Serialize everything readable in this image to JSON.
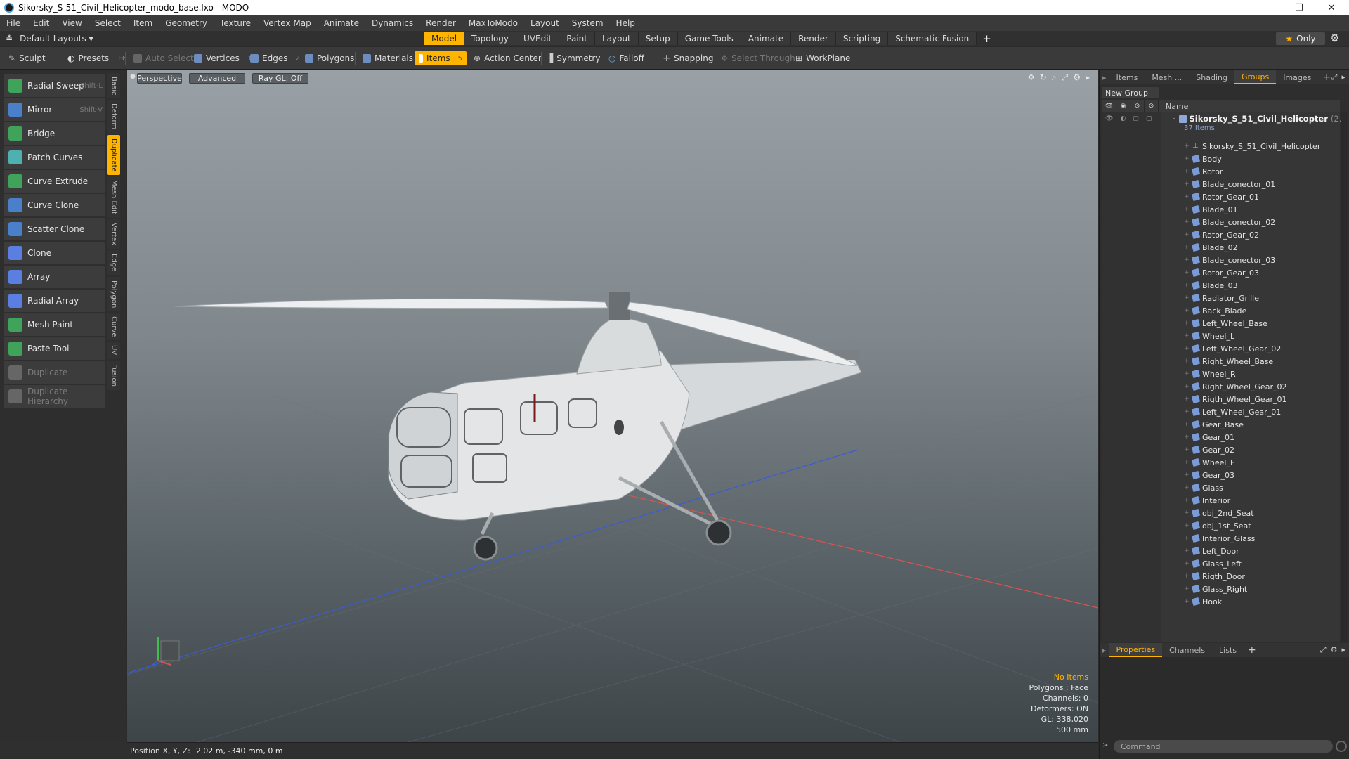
{
  "window": {
    "title": "Sikorsky_S-51_Civil_Helicopter_modo_base.lxo - MODO",
    "controls": [
      "—",
      "❐",
      "✕"
    ]
  },
  "menu": [
    "File",
    "Edit",
    "View",
    "Select",
    "Item",
    "Geometry",
    "Texture",
    "Vertex Map",
    "Animate",
    "Dynamics",
    "Render",
    "MaxToModo",
    "Layout",
    "System",
    "Help"
  ],
  "layoutbar": {
    "layout_selector": "Default Layouts ▾",
    "tabs": [
      "Model",
      "Topology",
      "UVEdit",
      "Paint",
      "Layout",
      "Setup",
      "Game Tools",
      "Animate",
      "Render",
      "Scripting",
      "Schematic Fusion"
    ],
    "active_tab": "Model",
    "plus": "+",
    "only_label": "Only"
  },
  "toolbar": {
    "sculpt": "Sculpt",
    "presets": "Presets",
    "presets_key": "F6",
    "auto_select": "Auto Select",
    "vertices": "Vertices",
    "vertices_count": "1",
    "edges": "Edges",
    "edges_count": "2",
    "polygons": "Polygons",
    "materials": "Materials",
    "items": "Items",
    "items_count": "5",
    "action_center": "Action Center",
    "symmetry": "Symmetry",
    "falloff": "Falloff",
    "snapping": "Snapping",
    "select_through": "Select Through",
    "workplane": "WorkPlane"
  },
  "tools": [
    {
      "label": "Radial Sweep",
      "shortcut": "Shift-L",
      "color": "#3fa35a",
      "enabled": true
    },
    {
      "label": "Mirror",
      "shortcut": "Shift-V",
      "color": "#4a7fc9",
      "enabled": true
    },
    {
      "label": "Bridge",
      "shortcut": "",
      "color": "#3fa35a",
      "enabled": true
    },
    {
      "label": "Patch Curves",
      "shortcut": "",
      "color": "#4fb0b0",
      "enabled": true
    },
    {
      "label": "Curve Extrude",
      "shortcut": "",
      "color": "#3fa35a",
      "enabled": true
    },
    {
      "label": "Curve Clone",
      "shortcut": "",
      "color": "#4a7fc9",
      "enabled": true
    },
    {
      "label": "Scatter Clone",
      "shortcut": "",
      "color": "#4a7fc9",
      "enabled": true
    },
    {
      "label": "Clone",
      "shortcut": "",
      "color": "#5a7fe0",
      "enabled": true
    },
    {
      "label": "Array",
      "shortcut": "",
      "color": "#5a7fe0",
      "enabled": true
    },
    {
      "label": "Radial Array",
      "shortcut": "",
      "color": "#5a7fe0",
      "enabled": true
    },
    {
      "label": "Mesh Paint",
      "shortcut": "",
      "color": "#3fa35a",
      "enabled": true
    },
    {
      "label": "Paste Tool",
      "shortcut": "",
      "color": "#3fa35a",
      "enabled": true
    },
    {
      "label": "Duplicate",
      "shortcut": "",
      "color": "#666666",
      "enabled": false
    },
    {
      "label": "Duplicate Hierarchy",
      "shortcut": "",
      "color": "#666666",
      "enabled": false
    }
  ],
  "vertical_tabs": [
    "Basic",
    "Deform",
    "Duplicate",
    "Mesh Edit",
    "Vertex",
    "Edge",
    "Polygon",
    "Curve",
    "UV",
    "Fusion"
  ],
  "active_vertical_tab": "Duplicate",
  "viewport": {
    "view_mode": "Perspective",
    "shading": "Advanced",
    "raygl": "Ray GL: Off",
    "info": {
      "selection": "No Items",
      "polygons": "Polygons : Face",
      "channels": "Channels: 0",
      "deformers": "Deformers: ON",
      "gl": "GL: 338,020",
      "scale": "500 mm"
    }
  },
  "statusbar": {
    "label": "Position X, Y, Z:",
    "value": "2.02 m, -340 mm, 0 m"
  },
  "right_panel": {
    "tabs": [
      "Items",
      "Mesh ...",
      "Shading",
      "Groups",
      "Images"
    ],
    "active_tab": "Groups",
    "new_group": "New Group",
    "column_name": "Name",
    "root_name": "Sikorsky_S_51_Civil_Helicopter",
    "root_suffix": "(2...",
    "root_count": "37 Items",
    "items": [
      "Sikorsky_S_51_Civil_Helicopter",
      "Body",
      "Rotor",
      "Blade_conector_01",
      "Rotor_Gear_01",
      "Blade_01",
      "Blade_conector_02",
      "Rotor_Gear_02",
      "Blade_02",
      "Blade_conector_03",
      "Rotor_Gear_03",
      "Blade_03",
      "Radiator_Grille",
      "Back_Blade",
      "Left_Wheel_Base",
      "Wheel_L",
      "Left_Wheel_Gear_02",
      "Right_Wheel_Base",
      "Wheel_R",
      "Right_Wheel_Gear_02",
      "Rigth_Wheel_Gear_01",
      "Left_Wheel_Gear_01",
      "Gear_Base",
      "Gear_01",
      "Gear_02",
      "Wheel_F",
      "Gear_03",
      "Glass",
      "Interior",
      "obj_2nd_Seat",
      "obj_1st_Seat",
      "Interior_Glass",
      "Left_Door",
      "Glass_Left",
      "Rigth_Door",
      "Glass_Right",
      "Hook"
    ],
    "lower_tabs": [
      "Properties",
      "Channels",
      "Lists"
    ],
    "lower_active": "Properties",
    "command_placeholder": "Command"
  },
  "colors": {
    "accent": "#ffb400",
    "x_axis": "#d9534f",
    "z_axis": "#3b5bd6"
  }
}
